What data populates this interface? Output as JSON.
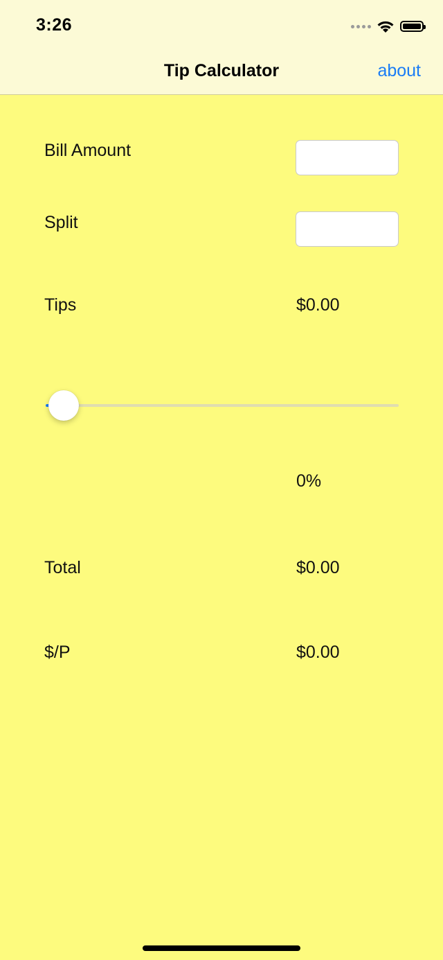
{
  "status_bar": {
    "time": "3:26",
    "icons": [
      "signal-dots-icon",
      "wifi-icon",
      "battery-icon"
    ]
  },
  "nav": {
    "title": "Tip Calculator",
    "about_label": "about"
  },
  "form": {
    "bill_label": "Bill Amount",
    "bill_value": "",
    "split_label": "Split",
    "split_value": "",
    "tips_label": "Tips",
    "tips_value": "$0.00",
    "tip_percent": "0%",
    "tip_slider_value": 0,
    "total_label": "Total",
    "total_value": "$0.00",
    "per_person_label": "$/P",
    "per_person_value": "$0.00"
  },
  "colors": {
    "background": "#FDFB7E",
    "nav_background": "#FCFAD6",
    "accent": "#1a7cf5"
  }
}
